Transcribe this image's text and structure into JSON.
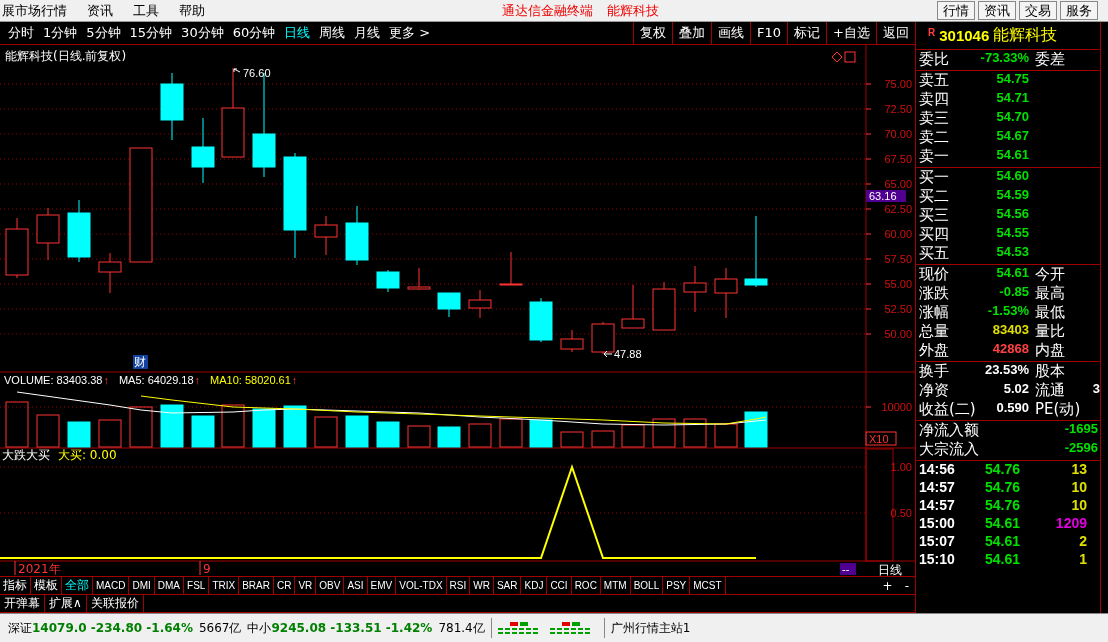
{
  "menu_bar": {
    "items": [
      "展市场行情",
      "资讯",
      "工具",
      "帮助"
    ],
    "title": [
      "通达信金融终端",
      "能辉科技"
    ],
    "buttons": [
      "行情",
      "资讯",
      "交易",
      "服务"
    ]
  },
  "period_tabs": [
    {
      "label": "分时",
      "selected": false
    },
    {
      "label": "1分钟",
      "selected": false
    },
    {
      "label": "5分钟",
      "selected": false
    },
    {
      "label": "15分钟",
      "selected": false
    },
    {
      "label": "30分钟",
      "selected": false
    },
    {
      "label": "60分钟",
      "selected": false
    },
    {
      "label": "日线",
      "selected": true
    },
    {
      "label": "周线",
      "selected": false
    },
    {
      "label": "月线",
      "selected": false
    },
    {
      "label": "更多 >",
      "selected": false
    }
  ],
  "chart_buttons": [
    "复权",
    "叠加",
    "画线",
    "F10",
    "标记",
    "+自选",
    "返回"
  ],
  "chart": {
    "title": "能辉科技(日线.前复权)",
    "price_ticks": [
      "75.00",
      "72.50",
      "70.00",
      "67.50",
      "65.00",
      "62.50",
      "60.00",
      "57.50",
      "55.00",
      "52.50",
      "50.00"
    ],
    "price_tag": "63.16",
    "high_note": "76.60",
    "low_note": "47.88",
    "finance_badge": "财"
  },
  "volume": {
    "legend": [
      {
        "label": "VOLUME: 83403.38",
        "arrow": "↑",
        "color": "#ffffff"
      },
      {
        "label": "MA5: 64029.18",
        "arrow": "↑",
        "color": "#ffffff"
      },
      {
        "label": "MA10: 58020.61",
        "arrow": "↑",
        "color": "#ffff00"
      }
    ],
    "tick": "10000",
    "scale": "X10"
  },
  "indicator": {
    "name": "大跌大买",
    "legend": "大买: 0.00",
    "ticks": [
      "1.00",
      "0.50"
    ]
  },
  "x_axis": {
    "labels": [
      "2021年",
      "9"
    ],
    "period_box": "--",
    "period": "日线"
  },
  "indicator_tabs": [
    {
      "label": "指标",
      "selected": false
    },
    {
      "label": "模板",
      "selected": false
    },
    {
      "label": "全部",
      "selected": true
    },
    {
      "label": "MACD",
      "selected": false
    },
    {
      "label": "DMI",
      "selected": false
    },
    {
      "label": "DMA",
      "selected": false
    },
    {
      "label": "FSL",
      "selected": false
    },
    {
      "label": "TRIX",
      "selected": false
    },
    {
      "label": "BRAR",
      "selected": false
    },
    {
      "label": "CR",
      "selected": false
    },
    {
      "label": "VR",
      "selected": false
    },
    {
      "label": "OBV",
      "selected": false
    },
    {
      "label": "ASI",
      "selected": false
    },
    {
      "label": "EMV",
      "selected": false
    },
    {
      "label": "VOL-TDX",
      "selected": false
    },
    {
      "label": "RSI",
      "selected": false
    },
    {
      "label": "WR",
      "selected": false
    },
    {
      "label": "SAR",
      "selected": false
    },
    {
      "label": "KDJ",
      "selected": false
    },
    {
      "label": "CCI",
      "selected": false
    },
    {
      "label": "ROC",
      "selected": false
    },
    {
      "label": "MTM",
      "selected": false
    },
    {
      "label": "BOLL",
      "selected": false
    },
    {
      "label": "PSY",
      "selected": false
    },
    {
      "label": "MCST",
      "selected": false
    }
  ],
  "zoom_buttons": [
    "+",
    "-"
  ],
  "extra_tabs": [
    "开弹幕",
    "扩展∧",
    "关联报价"
  ],
  "quote_panel": {
    "flag": "R",
    "code": "301046",
    "name": "能辉科技",
    "ratio": {
      "label": "委比",
      "value": "-73.33%",
      "label2": "委差"
    },
    "asks": [
      {
        "label": "卖五",
        "price": "54.75"
      },
      {
        "label": "卖四",
        "price": "54.71"
      },
      {
        "label": "卖三",
        "price": "54.70"
      },
      {
        "label": "卖二",
        "price": "54.67"
      },
      {
        "label": "卖一",
        "price": "54.61"
      }
    ],
    "bids": [
      {
        "label": "买一",
        "price": "54.60"
      },
      {
        "label": "买二",
        "price": "54.59"
      },
      {
        "label": "买三",
        "price": "54.56"
      },
      {
        "label": "买四",
        "price": "54.55"
      },
      {
        "label": "买五",
        "price": "54.53"
      }
    ],
    "stats": [
      {
        "label": "现价",
        "value": "54.61",
        "label2": "今开",
        "color": "#00e000"
      },
      {
        "label": "涨跌",
        "value": "-0.85",
        "label2": "最高",
        "color": "#00e000"
      },
      {
        "label": "涨幅",
        "value": "-1.53%",
        "label2": "最低",
        "color": "#00e000"
      },
      {
        "label": "总量",
        "value": "83403",
        "label2": "量比",
        "color": "#e0e000"
      },
      {
        "label": "外盘",
        "value": "42868",
        "label2": "内盘",
        "color": "#ff4040"
      }
    ],
    "info": [
      {
        "label": "换手",
        "value": "23.53%",
        "label2": "股本"
      },
      {
        "label": "净资",
        "value": "5.02",
        "label2": "流通",
        "value2": "3"
      },
      {
        "label": "收益(二)",
        "value": "0.590",
        "label2": "PE(动)"
      }
    ],
    "flows": [
      {
        "label": "净流入额",
        "value": "-1695"
      },
      {
        "label": "大宗流入",
        "value": "-2596"
      }
    ],
    "trades": [
      {
        "time": "14:56",
        "price": "54.76",
        "volume": "13",
        "color": "#e0e000"
      },
      {
        "time": "14:57",
        "price": "54.76",
        "volume": "10",
        "color": "#e0e000"
      },
      {
        "time": "14:57",
        "price": "54.76",
        "volume": "10",
        "color": "#e0e000"
      },
      {
        "time": "15:00",
        "price": "54.61",
        "volume": "1209",
        "color": "#e000e0"
      },
      {
        "time": "15:07",
        "price": "54.61",
        "volume": "2",
        "color": "#e0e000"
      },
      {
        "time": "15:10",
        "price": "54.61",
        "volume": "1",
        "color": "#e0e000"
      }
    ]
  },
  "status_bar": {
    "indices": [
      {
        "name": "深证",
        "quote": "14079.0 -234.80 -1.64%",
        "amount": "5667亿"
      },
      {
        "name": "中小",
        "quote": "9245.08 -133.51 -1.42%",
        "amount": "781.4亿"
      }
    ],
    "server": "广州行情主站1"
  }
}
